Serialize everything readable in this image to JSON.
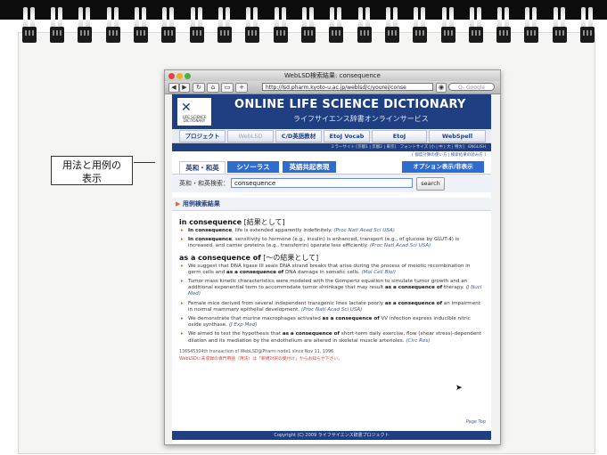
{
  "callout": {
    "line1": "用法と用例の",
    "line2": "表示"
  },
  "browser": {
    "title": "WebLSD検索結果: consequence",
    "url": "http://lsd.pharm.kyoto-u.ac.jp/weblsd/c/yourei/conse",
    "search_placeholder": "Q- Google"
  },
  "site": {
    "title": "ONLINE LIFE SCIENCE DICTIONARY",
    "subtitle": "ライフサイエンス辞書オンラインサービス",
    "logo_text": "LIFE SCIENCE DICTIONARY",
    "nav": [
      "プロジェクト",
      "WebLSD",
      "C/D英語教材",
      "EtoJ Vocab",
      "EtoJ",
      "WebSpell"
    ],
    "subnav": "ミラーサイト [京都1 | 京都2 | 東京]　フォントサイズ [小 | 中 | 大 | 特大]　ENGLISH",
    "toplinks": "[ 都度計算の使い方 | 検索結果の読み方 ]",
    "tabs": {
      "active": "英和・和英",
      "thesaurus": "シソーラス",
      "cooccur": "英語共起表現",
      "options": "オプション表示/非表示"
    },
    "search_label": "英和・和英検索：",
    "search_value": "consequence",
    "search_button": "search",
    "section_title": "用例検索結果",
    "page_top": "Page Top",
    "footer": "Copyright (C) 2009 ライフサイエンス辞書プロジェクト"
  },
  "entries": [
    {
      "phrase": "in consequence",
      "gloss": "[結果として]",
      "examples": [
        {
          "pre": "",
          "bold": "In consequence",
          "post": ", life is extended apparently indefinitely. ",
          "src": "(Proc Natl Acad Sci USA)"
        },
        {
          "pre": "",
          "bold": "In consequence",
          "post": ", sensitivity to hormone (e.g., insulin) is enhanced, transport (e.g., of glucose by GLUT-4) is increased, and carrier proteins (e.g., transferrin) operate less efficiently. ",
          "src": "(Proc Natl Acad Sci USA)"
        }
      ]
    },
    {
      "phrase": "as a consequence of",
      "gloss": "[〜の結果として]",
      "examples": [
        {
          "pre": "We suggest that DNA ligase III seals DNA strand breaks that arise during the process of meiotic recombination in germ cells and ",
          "bold": "as a consequence of",
          "post": " DNA damage in somatic cells. ",
          "src": "(Mol Cell Biol)"
        },
        {
          "pre": "Tumor mass kinetic characteristics were modeled with the Gompertz equation to simulate tumor growth and an additional exponential term to accommodate tumor shrinkage that may result ",
          "bold": "as a consequence of",
          "post": " therapy. ",
          "src": "(J Nucl Med)"
        },
        {
          "pre": "Female mice derived from several independent transgenic lines lactate poorly ",
          "bold": "as a consequence of",
          "post": " an impairment in normal mammary epithelial development. ",
          "src": "(Proc Natl Acad Sci USA)"
        },
        {
          "pre": "We demonstrate that murine macrophages activated ",
          "bold": "as a consequence of",
          "post": " VV infection express inducible nitric oxide synthase. ",
          "src": "(J Exp Med)"
        },
        {
          "pre": "We aimed to test the hypothesis that ",
          "bold": "as a consequence of",
          "post": " short-term daily exercise, flow (shear stress)-dependent dilation and its mediation by the endothelium are altered in skeletal muscle arterioles. ",
          "src": "(Circ Res)"
        }
      ]
    }
  ],
  "count_text": "136545304th transaction of WebLSD@Pharm node1 since Nov 11, 1996",
  "note_text": "WebLSDに未収録の専門用語（用法）は「新規対訳の受付け」からお知らせ下さい。",
  "colors": {
    "brand_blue": "#1f3f82",
    "accent_orange": "#e4682c",
    "tab_blue": "#2e6ccf"
  }
}
